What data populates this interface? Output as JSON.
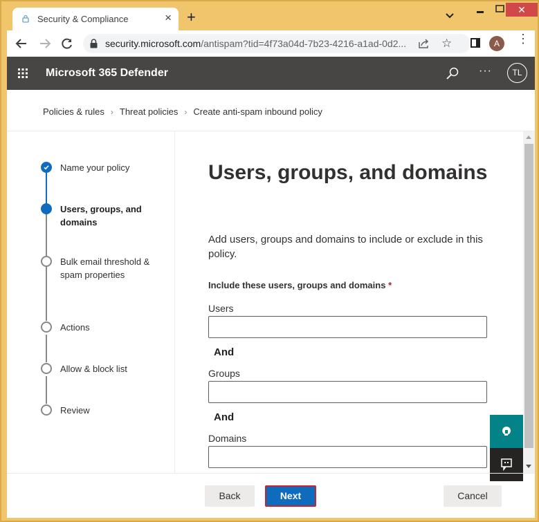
{
  "browser": {
    "tab_title": "Security & Compliance",
    "tab_close": "×",
    "new_tab": "+",
    "url_host": "security.microsoft.com",
    "url_rest": "/antispam?tid=4f73a04d-7b23-4216-a1ad-0d2...",
    "profile_initial": "A",
    "menu_glyph": "⋮",
    "close_glyph": "✕",
    "star_glyph": "☆"
  },
  "app": {
    "title": "Microsoft 365 Defender",
    "more_glyph": "···",
    "avatar_initials": "TL"
  },
  "breadcrumb": {
    "items": [
      "Policies & rules",
      "Threat policies",
      "Create anti-spam inbound policy"
    ],
    "separator": "›"
  },
  "steps": [
    {
      "label": "Name your policy",
      "status": "done"
    },
    {
      "label": "Users, groups, and domains",
      "status": "current"
    },
    {
      "label": "Bulk email threshold & spam properties",
      "status": "pending"
    },
    {
      "label": "Actions",
      "status": "pending"
    },
    {
      "label": "Allow & block list",
      "status": "pending"
    },
    {
      "label": "Review",
      "status": "pending"
    }
  ],
  "content": {
    "heading": "Users, groups, and domains",
    "description": "Add users, groups and domains to include or exclude in this policy.",
    "section_label": "Include these users, groups and domains",
    "required_marker": "*",
    "fields": [
      {
        "label": "Users",
        "value": ""
      },
      {
        "label": "Groups",
        "value": ""
      },
      {
        "label": "Domains",
        "value": ""
      }
    ],
    "and_label": "And"
  },
  "footer": {
    "back": "Back",
    "next": "Next",
    "cancel": "Cancel"
  },
  "colors": {
    "accent": "#0f6cbd",
    "appbar": "#484644",
    "help_button": "#038387",
    "highlight_border": "#c0283a"
  }
}
